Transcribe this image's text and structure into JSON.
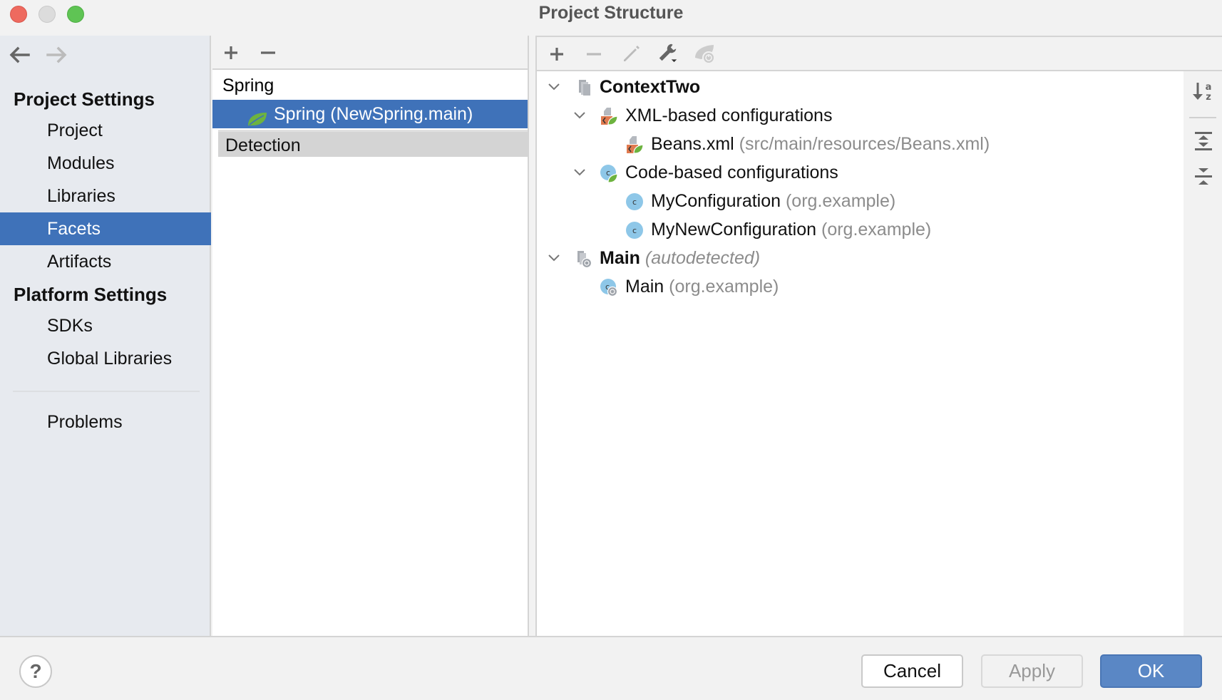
{
  "window": {
    "title": "Project Structure"
  },
  "sidebar": {
    "sections": [
      {
        "header": "Project Settings",
        "items": [
          {
            "label": "Project",
            "selected": false
          },
          {
            "label": "Modules",
            "selected": false
          },
          {
            "label": "Libraries",
            "selected": false
          },
          {
            "label": "Facets",
            "selected": true
          },
          {
            "label": "Artifacts",
            "selected": false
          }
        ]
      },
      {
        "header": "Platform Settings",
        "items": [
          {
            "label": "SDKs",
            "selected": false
          },
          {
            "label": "Global Libraries",
            "selected": false
          }
        ]
      }
    ],
    "problems_label": "Problems",
    "nav": {
      "back_icon": "arrow-left-icon",
      "forward_icon": "arrow-right-icon"
    }
  },
  "facets_panel": {
    "toolbar": {
      "add_icon": "plus-icon",
      "remove_icon": "minus-icon"
    },
    "group_label": "Spring",
    "selected_facet": "Spring (NewSpring.main)",
    "detection_label": "Detection"
  },
  "context_panel": {
    "toolbar": {
      "add_icon": "plus-icon",
      "remove_icon": "minus-icon",
      "edit_icon": "pencil-icon",
      "settings_icon": "wrench-dropdown-icon",
      "run_icon": "spring-boot-icon"
    },
    "tree": [
      {
        "label": "ContextTwo",
        "hint": "",
        "style": "bold",
        "level": 0,
        "icon": "context-files-icon",
        "expanded": true
      },
      {
        "label": "XML-based configurations",
        "hint": "",
        "style": "normal",
        "level": 1,
        "icon": "spring-xml-icon",
        "expanded": true
      },
      {
        "label": "Beans.xml",
        "hint": "(src/main/resources/Beans.xml)",
        "style": "normal",
        "level": 2,
        "icon": "spring-xml-icon",
        "expanded": null
      },
      {
        "label": "Code-based configurations",
        "hint": "",
        "style": "normal",
        "level": 1,
        "icon": "spring-class-icon",
        "expanded": true
      },
      {
        "label": "MyConfiguration",
        "hint": "(org.example)",
        "style": "normal",
        "level": 2,
        "icon": "class-icon",
        "expanded": null
      },
      {
        "label": "MyNewConfiguration",
        "hint": "(org.example)",
        "style": "normal",
        "level": 2,
        "icon": "class-icon",
        "expanded": null
      },
      {
        "label": "Main",
        "hint": "(autodetected)",
        "style": "bold-italic-hint",
        "level": 0,
        "icon": "autodetected-context-icon",
        "expanded": true
      },
      {
        "label": "Main",
        "hint": "(org.example)",
        "style": "normal",
        "level": 1,
        "icon": "boot-class-icon",
        "expanded": null
      }
    ],
    "side_toolbar": {
      "sort_icon": "sort-alphabetically-icon",
      "expand_icon": "expand-all-icon",
      "collapse_icon": "collapse-all-icon"
    }
  },
  "footer": {
    "help_label": "?",
    "cancel_label": "Cancel",
    "apply_label": "Apply",
    "ok_label": "OK"
  },
  "colors": {
    "accent": "#3f72b9",
    "ok_button": "#5a87c5",
    "sidebar_bg": "#e7eaef",
    "hint_text": "#8c8c8c",
    "spring_green": "#6db33f",
    "xml_orange": "#e07a4f",
    "class_blue": "#8ec7e8"
  }
}
